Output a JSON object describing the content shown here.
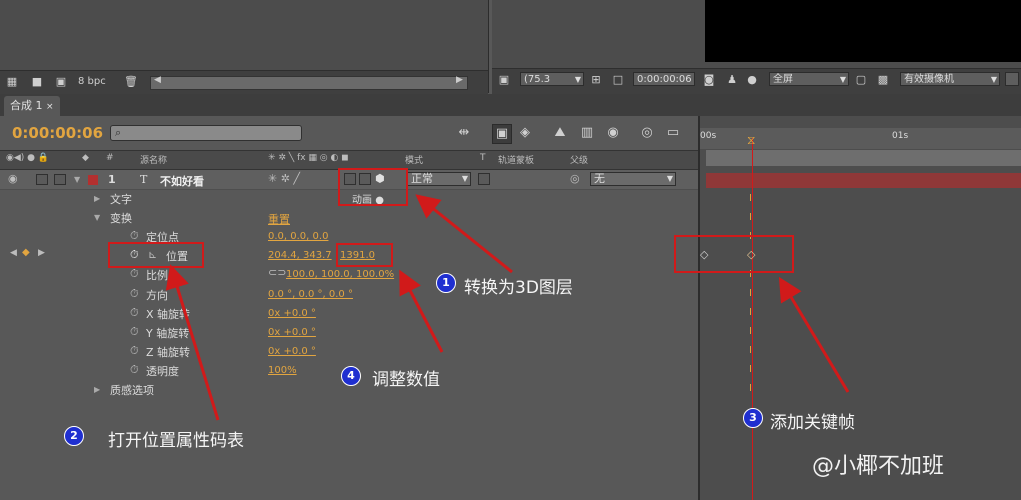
{
  "project_bar": {
    "bpc": "8 bpc"
  },
  "viewer_bar": {
    "zoom": "(75.3",
    "timecode": "0:00:00:06",
    "resolution": "全屏",
    "camera": "有效摄像机"
  },
  "comp_tab": {
    "label": "合成 1"
  },
  "timeline": {
    "current_time": "0:00:00:06",
    "ruler": {
      "start": "00s",
      "mark": "01s"
    }
  },
  "columns": {
    "source_name": "源名称",
    "mode": "模式",
    "t": "T",
    "trkmat": "轨道蒙板",
    "parent": "父级"
  },
  "layer": {
    "index": "1",
    "type_glyph": "T",
    "name": "不如好看",
    "mode": "正常",
    "parent": "无",
    "animate": "动画"
  },
  "properties": {
    "text": "文字",
    "transform": "变换",
    "reset": "重置",
    "anchor": {
      "label": "定位点",
      "value": "0.0, 0.0, 0.0"
    },
    "position": {
      "label": "位置",
      "value": "204.4, 343.7",
      "z": "1391.0"
    },
    "scale": {
      "label": "比例",
      "value": "100.0, 100.0, 100.0%"
    },
    "orientation": {
      "label": "方向",
      "value": "0.0 °, 0.0 °, 0.0 °"
    },
    "x_rot": {
      "label": "X 轴旋转",
      "value": "0x +0.0 °"
    },
    "y_rot": {
      "label": "Y 轴旋转",
      "value": "0x +0.0 °"
    },
    "z_rot": {
      "label": "Z 轴旋转",
      "value": "0x +0.0 °"
    },
    "opacity": {
      "label": "透明度",
      "value": "100%"
    },
    "material": "质感选项"
  },
  "annotations": {
    "a1": {
      "num": "1",
      "text": "转换为3D图层"
    },
    "a2": {
      "num": "2",
      "text": "打开位置属性码表"
    },
    "a3": {
      "num": "3",
      "text": "添加关键帧"
    },
    "a4": {
      "num": "4",
      "text": "调整数值"
    }
  },
  "watermark": "@小椰不加班",
  "colors": {
    "accent_orange": "#e2a540",
    "annotation_red": "#d11a1a",
    "annotation_blue": "#1f2fd0",
    "playhead": "#d21a1a"
  }
}
